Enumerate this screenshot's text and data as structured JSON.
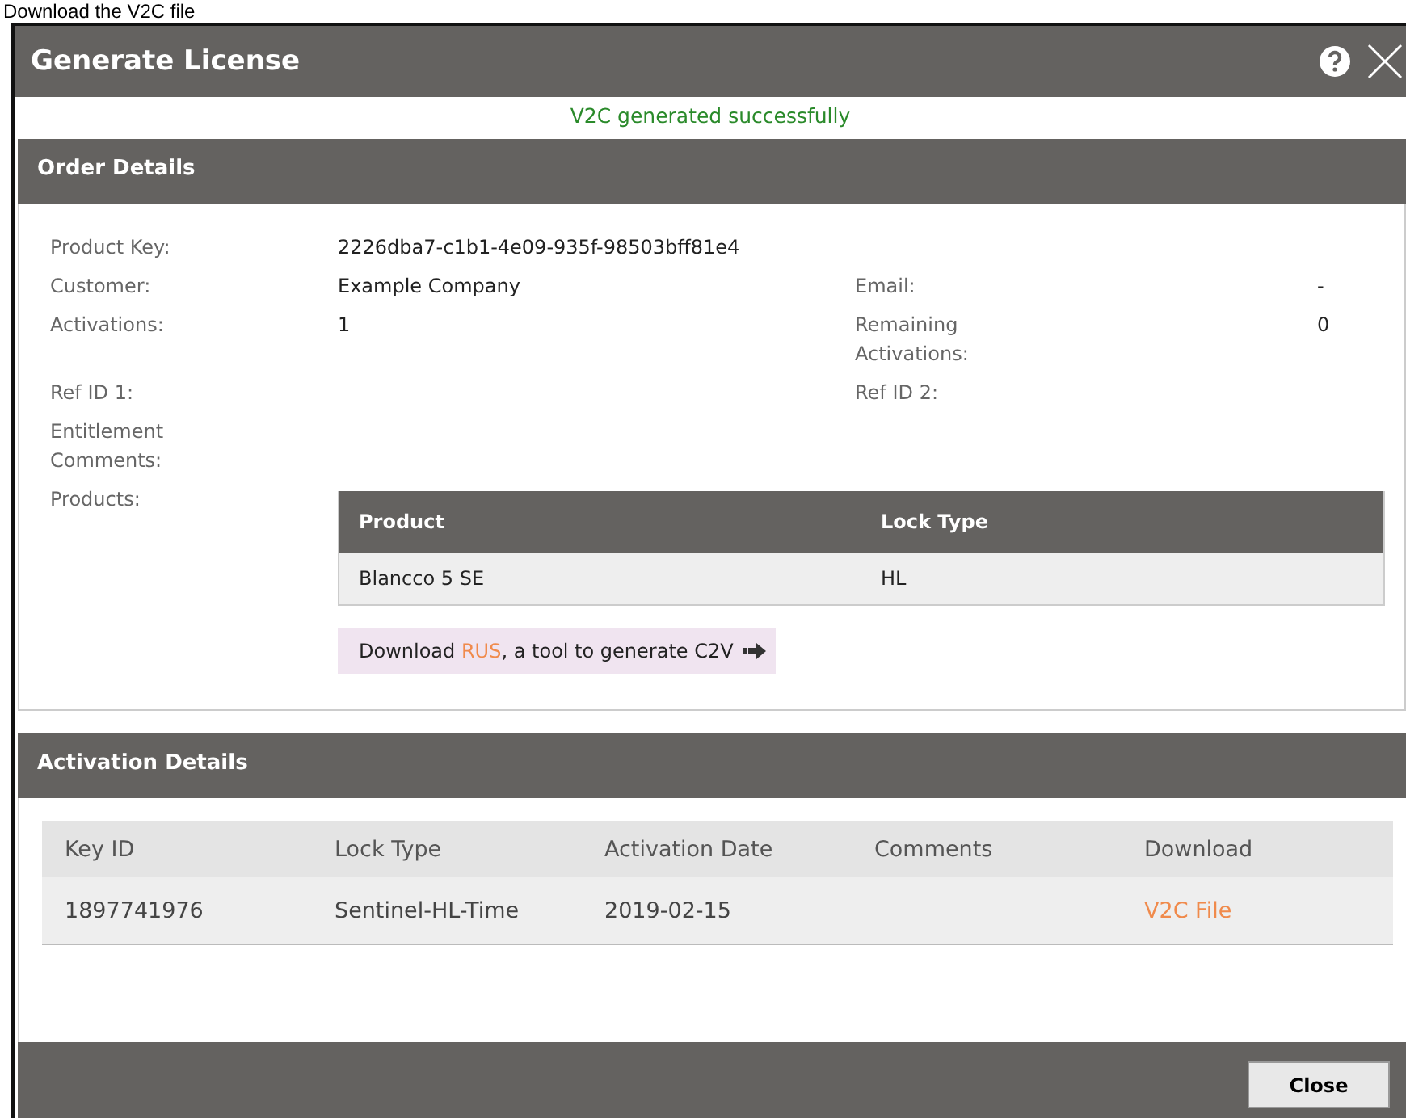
{
  "caption": "Download the V2C file",
  "window": {
    "title": "Generate License"
  },
  "message": "V2C generated successfully",
  "order_details": {
    "title": "Order Details",
    "fields": [
      {
        "label": "Product Key:",
        "value": "2226dba7-c1b1-4e09-935f-98503bff81e4"
      },
      {
        "label": "Customer:",
        "value": "Example Company",
        "label_2": "Email:",
        "value_2": "-"
      },
      {
        "label": "Activations:",
        "value": "1",
        "label_2": "Remaining Activations:",
        "value_2": "0"
      },
      {
        "label": "Ref ID 1:",
        "label_2": "Ref ID 2:"
      },
      {
        "label": "Entitlement Comments:"
      }
    ],
    "products_label": "Products:",
    "products": {
      "columns": [
        "Product",
        "Lock Type"
      ],
      "rows": [
        [
          "Blancco 5 SE",
          "HL"
        ]
      ]
    },
    "download_hint": {
      "before": "Download ",
      "link": "RUS",
      "after": ", a tool to generate C2V"
    }
  },
  "activation_details": {
    "title": "Activation Details",
    "columns": [
      "Key ID",
      "Lock Type",
      "Activation Date",
      "Comments",
      "Download"
    ],
    "rows": [
      {
        "cells": [
          "1897741976",
          "Sentinel-HL-Time",
          "2019-02-15",
          ""
        ],
        "link": "V2C File"
      }
    ]
  },
  "buttons": [
    "Close"
  ]
}
